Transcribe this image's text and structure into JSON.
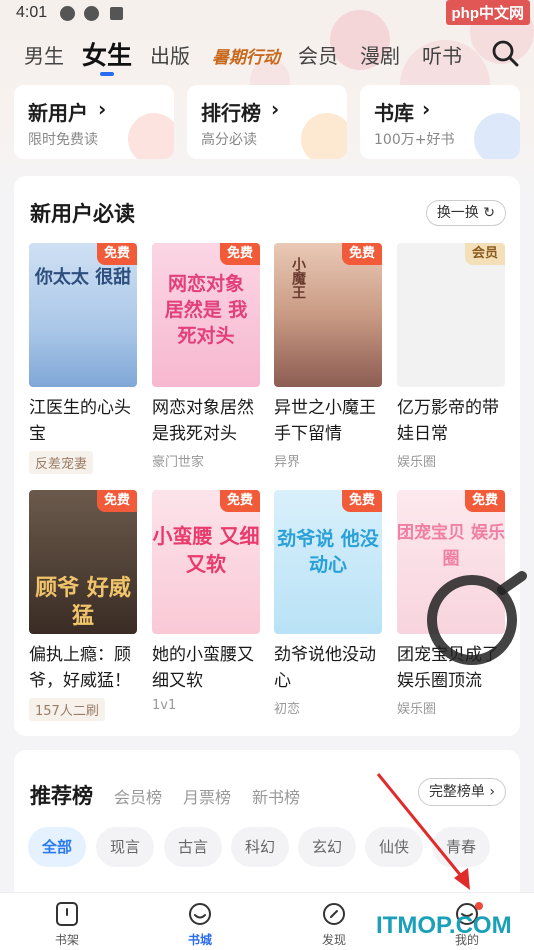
{
  "status_bar": {
    "time": "4:01"
  },
  "watermark": "php中文网",
  "top_tabs": [
    {
      "label": "男生"
    },
    {
      "label": "女生"
    },
    {
      "label": "出版"
    },
    {
      "label": "暑期行动"
    },
    {
      "label": "会员"
    },
    {
      "label": "漫剧"
    },
    {
      "label": "听书"
    }
  ],
  "quick_cards": [
    {
      "title": "新用户",
      "subtitle": "限时免费读"
    },
    {
      "title": "排行榜",
      "subtitle": "高分必读"
    },
    {
      "title": "书库",
      "subtitle": "100万+好书"
    }
  ],
  "new_user_section": {
    "title": "新用户必读",
    "swap_label": "换一换",
    "books": [
      {
        "title": "江医生的心头宝",
        "tag": "反差宠妻",
        "badge": "免费",
        "cover_text": "你太太 很甜"
      },
      {
        "title": "网恋对象居然是我死对头",
        "tag": "豪门世家",
        "badge": "免费",
        "cover_text": "网恋对象 居然是 我死对头"
      },
      {
        "title": "异世之小魔王手下留情",
        "tag": "异界",
        "badge": "免费",
        "cover_text": "小魔王"
      },
      {
        "title": "亿万影帝的带娃日常",
        "tag": "娱乐圈",
        "badge": "会员",
        "cover_text": ""
      },
      {
        "title": "偏执上瘾：顾爷，好威猛！",
        "tag": "157人二刷",
        "badge": "免费",
        "cover_text": "顾爷 好威猛"
      },
      {
        "title": "她的小蛮腰又细又软",
        "tag": "1v1",
        "badge": "免费",
        "cover_text": "小蛮腰 又细又软"
      },
      {
        "title": "劲爷说他没动心",
        "tag": "初恋",
        "badge": "免费",
        "cover_text": "劲爷说 他没动心"
      },
      {
        "title": "团宠宝贝成了娱乐圈顶流",
        "tag": "娱乐圈",
        "badge": "免费",
        "cover_text": "团宠宝贝 娱乐圈"
      }
    ]
  },
  "rank_section": {
    "tabs": [
      {
        "label": "推荐榜"
      },
      {
        "label": "会员榜"
      },
      {
        "label": "月票榜"
      },
      {
        "label": "新书榜"
      }
    ],
    "full_list_label": "完整榜单",
    "chips": [
      "全部",
      "现言",
      "古言",
      "科幻",
      "玄幻",
      "仙侠",
      "青春"
    ]
  },
  "bottom_nav": [
    {
      "label": "书架"
    },
    {
      "label": "书城"
    },
    {
      "label": "发现"
    },
    {
      "label": "我的"
    }
  ],
  "footer_watermark": "ITMOP.COM",
  "colors": {
    "accent": "#2a6cf0",
    "free_badge": "#f25b3a",
    "vip_badge": "#f3dfb8"
  }
}
